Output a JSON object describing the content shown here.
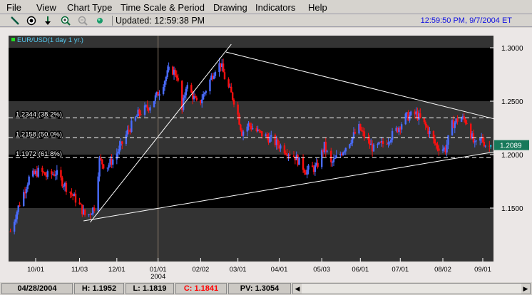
{
  "menu": [
    "File",
    "View",
    "Chart Type",
    "Time Scale & Period",
    "Drawing",
    "Indicators",
    "Help"
  ],
  "toolbar": {
    "icons": [
      "trendline-icon",
      "crosshair-icon",
      "download-arrow-icon",
      "zoom-in-icon",
      "zoom-out-icon",
      "globe-icon"
    ],
    "updated": "Updated: 12:59:38 PM",
    "clock": "12:59:50 PM, 9/7/2004 ET"
  },
  "footer": {
    "date": "04/28/2004",
    "high": "H: 1.1952",
    "low": "L: 1.1819",
    "close": "C: 1.1841",
    "pv": "PV: 1.3054",
    "close_color": "#ff0000"
  },
  "chart_data": {
    "type": "candlestick",
    "title": "EUR/USD(1 day  1 yr.)",
    "colors": {
      "up": "#4a6cff",
      "down": "#ff1010",
      "bandDark": "#333333",
      "bandBlack": "#000000",
      "lastPrice": "#17795a"
    },
    "ylim": [
      1.1,
      1.3117
    ],
    "yticks": [
      "1.3000",
      "1.2500",
      "1.2000",
      "1.1500"
    ],
    "xlim": [
      "2003-09-11",
      "2004-09-10"
    ],
    "xticks": [
      {
        "date": "2003-10-01",
        "label": "10/01"
      },
      {
        "date": "2003-11-03",
        "label": "11/03"
      },
      {
        "date": "2003-12-01",
        "label": "12/01"
      },
      {
        "date": "2004-01-01",
        "label": "01/01",
        "sub": "2004"
      },
      {
        "date": "2004-02-02",
        "label": "02/02"
      },
      {
        "date": "2004-03-01",
        "label": "03/01"
      },
      {
        "date": "2004-04-01",
        "label": "04/01"
      },
      {
        "date": "2004-05-03",
        "label": "05/03"
      },
      {
        "date": "2004-06-01",
        "label": "06/01"
      },
      {
        "date": "2004-07-01",
        "label": "07/01"
      },
      {
        "date": "2004-08-02",
        "label": "08/02"
      },
      {
        "date": "2004-09-01",
        "label": "09/01"
      }
    ],
    "last_price": "1.2089",
    "cursor_date": "2004-01-01",
    "fib_levels": [
      {
        "price": 1.2344,
        "label": "1.2344 (38.2%)"
      },
      {
        "price": 1.2158,
        "label": "1.2158 (50.0%)"
      },
      {
        "price": 1.1972,
        "label": "1.1972 (61.8%)"
      }
    ],
    "trendlines": [
      {
        "from": [
          "2003-11-11",
          1.1367
        ],
        "to": [
          "2004-02-25",
          1.3033
        ]
      },
      {
        "from": [
          "2004-02-21",
          1.296
        ],
        "to": [
          "2004-09-10",
          1.2333
        ]
      },
      {
        "from": [
          "2003-11-06",
          1.138
        ],
        "to": [
          "2004-09-10",
          1.2027
        ]
      }
    ],
    "closes_approx": [
      [
        "2003-09-12",
        1.128
      ],
      [
        "2003-09-18",
        1.151
      ],
      [
        "2003-09-26",
        1.178
      ],
      [
        "2003-10-04",
        1.185
      ],
      [
        "2003-10-09",
        1.18
      ],
      [
        "2003-10-16",
        1.183
      ],
      [
        "2003-10-25",
        1.168
      ],
      [
        "2003-11-02",
        1.155
      ],
      [
        "2003-11-08",
        1.141
      ],
      [
        "2003-11-14",
        1.151
      ],
      [
        "2003-11-18",
        1.195
      ],
      [
        "2003-11-23",
        1.188
      ],
      [
        "2003-11-29",
        1.197
      ],
      [
        "2003-12-04",
        1.208
      ],
      [
        "2003-12-09",
        1.221
      ],
      [
        "2003-12-17",
        1.238
      ],
      [
        "2003-12-25",
        1.245
      ],
      [
        "2003-12-31",
        1.255
      ],
      [
        "2004-01-06",
        1.27
      ],
      [
        "2004-01-10",
        1.281
      ],
      [
        "2004-01-15",
        1.275
      ],
      [
        "2004-01-19",
        1.241
      ],
      [
        "2004-01-22",
        1.265
      ],
      [
        "2004-01-27",
        1.255
      ],
      [
        "2004-01-31",
        1.245
      ],
      [
        "2004-02-06",
        1.261
      ],
      [
        "2004-02-13",
        1.281
      ],
      [
        "2004-02-17",
        1.285
      ],
      [
        "2004-02-21",
        1.268
      ],
      [
        "2004-02-28",
        1.248
      ],
      [
        "2004-03-04",
        1.221
      ],
      [
        "2004-03-09",
        1.228
      ],
      [
        "2004-03-16",
        1.221
      ],
      [
        "2004-03-25",
        1.215
      ],
      [
        "2004-04-05",
        1.205
      ],
      [
        "2004-04-13",
        1.198
      ],
      [
        "2004-04-21",
        1.185
      ],
      [
        "2004-04-29",
        1.188
      ],
      [
        "2004-05-05",
        1.208
      ],
      [
        "2004-05-10",
        1.191
      ],
      [
        "2004-05-17",
        1.201
      ],
      [
        "2004-05-23",
        1.211
      ],
      [
        "2004-05-31",
        1.225
      ],
      [
        "2004-06-05",
        1.215
      ],
      [
        "2004-06-11",
        1.205
      ],
      [
        "2004-06-19",
        1.211
      ],
      [
        "2004-06-27",
        1.221
      ],
      [
        "2004-07-05",
        1.235
      ],
      [
        "2004-07-13",
        1.238
      ],
      [
        "2004-07-21",
        1.225
      ],
      [
        "2004-07-28",
        1.208
      ],
      [
        "2004-08-04",
        1.205
      ],
      [
        "2004-08-09",
        1.228
      ],
      [
        "2004-08-15",
        1.235
      ],
      [
        "2004-08-20",
        1.231
      ],
      [
        "2004-08-26",
        1.208
      ],
      [
        "2004-08-31",
        1.215
      ],
      [
        "2004-09-05",
        1.206
      ],
      [
        "2004-09-07",
        1.2089
      ]
    ]
  }
}
